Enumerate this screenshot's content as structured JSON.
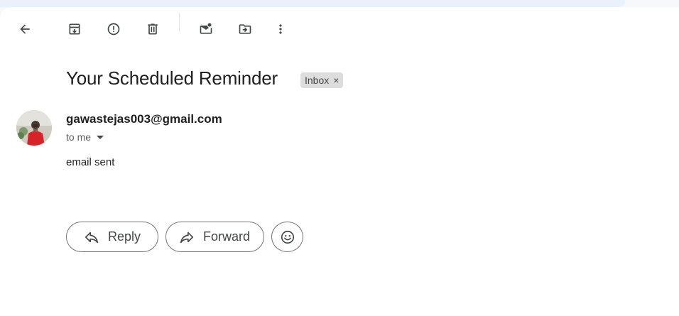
{
  "toolbar": {
    "back_icon": "arrow-back-icon",
    "archive_icon": "archive-icon",
    "spam_icon": "report-spam-icon",
    "delete_icon": "delete-icon",
    "mark_unread_icon": "mark-unread-icon",
    "move_icon": "move-to-icon",
    "more_icon": "more-vert-icon"
  },
  "message": {
    "subject": "Your Scheduled Reminder",
    "label": "Inbox",
    "label_remove": "×",
    "sender_email": "gawastejas003@gmail.com",
    "recipient": "to me",
    "body": "email sent"
  },
  "actions": {
    "reply": "Reply",
    "forward": "Forward",
    "emoji_icon": "emoji-reaction-icon"
  }
}
